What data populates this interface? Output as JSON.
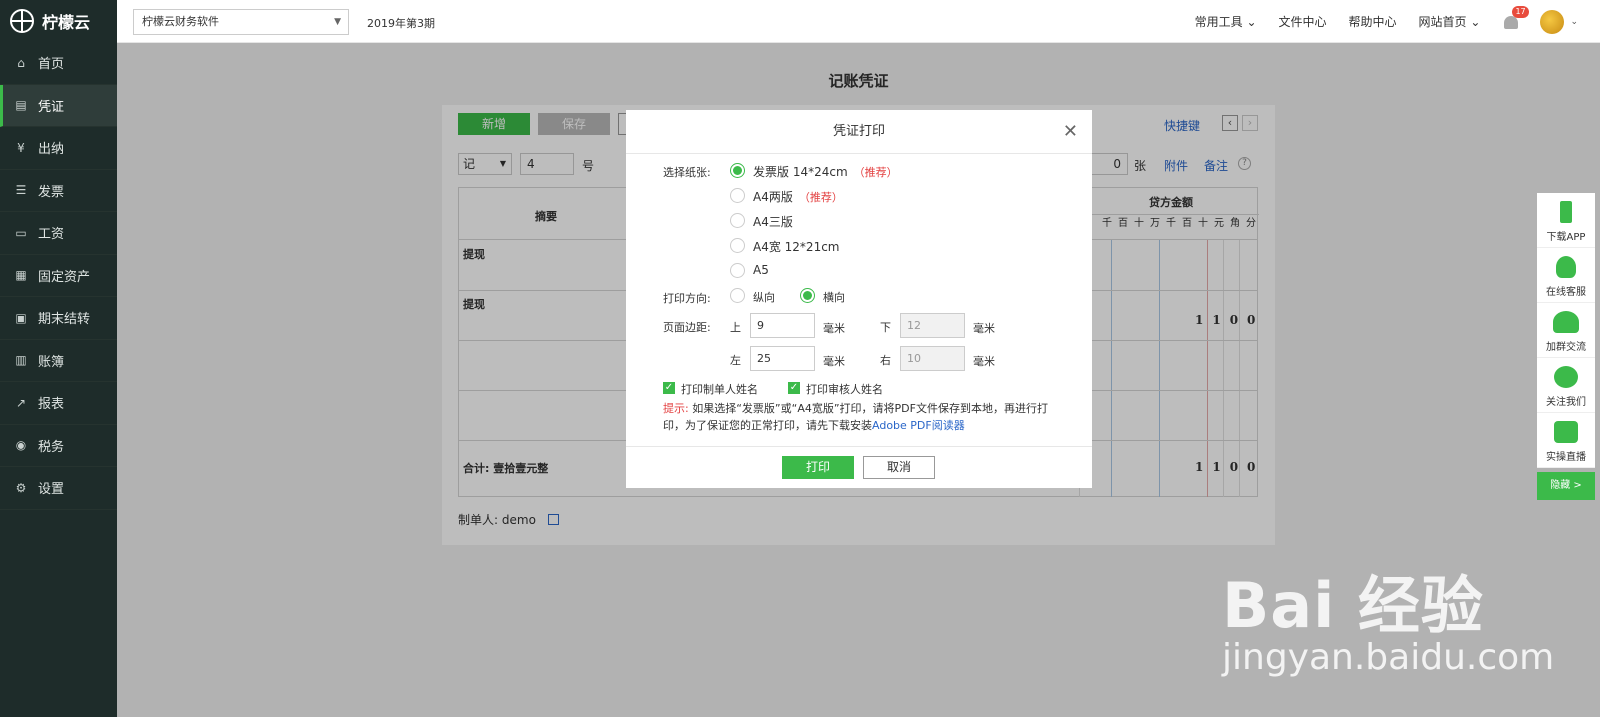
{
  "app": {
    "name": "柠檬云"
  },
  "sidebar": {
    "items": [
      {
        "label": "首页",
        "icon": "home-icon"
      },
      {
        "label": "凭证",
        "icon": "voucher-icon",
        "active": true
      },
      {
        "label": "出纳",
        "icon": "cashier-icon"
      },
      {
        "label": "发票",
        "icon": "invoice-icon"
      },
      {
        "label": "工资",
        "icon": "salary-icon"
      },
      {
        "label": "固定资产",
        "icon": "asset-icon"
      },
      {
        "label": "期末结转",
        "icon": "calendar-icon"
      },
      {
        "label": "账簿",
        "icon": "book-icon"
      },
      {
        "label": "报表",
        "icon": "chart-icon"
      },
      {
        "label": "税务",
        "icon": "tax-icon"
      },
      {
        "label": "设置",
        "icon": "gear-icon"
      }
    ]
  },
  "topbar": {
    "company": "柠檬云财务软件",
    "period": "2019年第3期",
    "links": [
      "常用工具",
      "文件中心",
      "帮助中心",
      "网站首页"
    ],
    "notification_count": "17"
  },
  "page": {
    "title": "记账凭证",
    "btn_new": "新增",
    "btn_save": "保存",
    "shortcut": "快捷键",
    "voucher_word": "记",
    "voucher_no": "4",
    "no_suffix": "号",
    "attach_count": "0",
    "zhang": "张",
    "attach_link": "附件",
    "note_link": "备注",
    "col_summary": "摘要",
    "col_credit": "贷方金额",
    "digit_headers": [
      "千",
      "百",
      "十",
      "万",
      "千",
      "百",
      "十",
      "元",
      "角",
      "分"
    ],
    "rows": [
      {
        "summary": "提现"
      },
      {
        "summary": "提现"
      }
    ],
    "row2_amount": "1100",
    "total_label": "合计: 壹拾壹元整",
    "total_amount": "1100",
    "maker_label": "制单人:",
    "maker_name": "demo"
  },
  "modal": {
    "title": "凭证打印",
    "paper_label": "选择纸张:",
    "paper_options": [
      {
        "label": "发票版 14*24cm",
        "tag": "（推荐）",
        "selected": true
      },
      {
        "label": "A4两版",
        "tag": "（推荐）",
        "selected": false
      },
      {
        "label": "A4三版",
        "tag": "",
        "selected": false
      },
      {
        "label": "A4宽 12*21cm",
        "tag": "",
        "selected": false
      },
      {
        "label": "A5",
        "tag": "",
        "selected": false
      }
    ],
    "orientation_label": "打印方向:",
    "orient_portrait": "纵向",
    "orient_landscape": "横向",
    "margin_label": "页面边距:",
    "top_label": "上",
    "top_value": "9",
    "bottom_label": "下",
    "bottom_value": "12",
    "left_label": "左",
    "left_value": "25",
    "right_label": "右",
    "right_value": "10",
    "unit": "毫米",
    "check_maker": "打印制单人姓名",
    "check_auditor": "打印审核人姓名",
    "tip_prefix": "提示:",
    "tip_text": "如果选择“发票版”或“A4宽版”打印，请将PDF文件保存到本地，再进行打印，为了保证您的正常打印，请先下载安装",
    "tip_link": "Adobe PDF阅读器",
    "btn_print": "打印",
    "btn_cancel": "取消"
  },
  "float_bar": {
    "items": [
      "下载APP",
      "在线客服",
      "加群交流",
      "关注我们",
      "实操直播"
    ],
    "hide": "隐藏 >"
  },
  "watermark": {
    "brand": "Bai 经验",
    "url": "jingyan.baidu.com"
  },
  "colors": {
    "sidebar": "#1e2c2a",
    "accent": "#3cba4a",
    "link": "#2a66c8",
    "recommend": "#e34040"
  }
}
